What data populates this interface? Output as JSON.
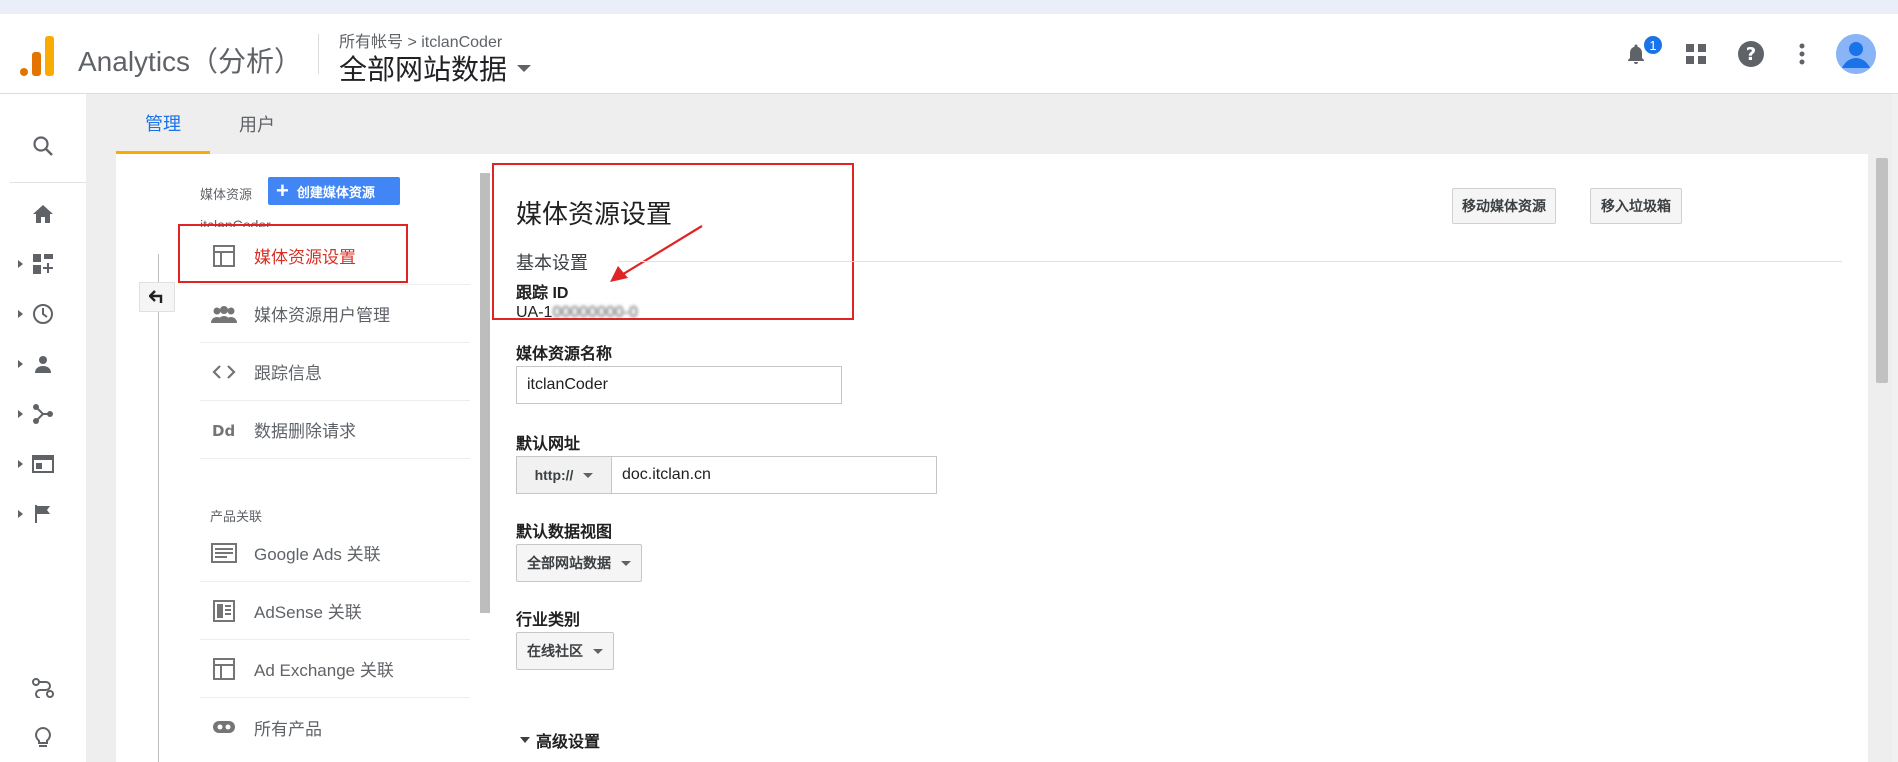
{
  "header": {
    "app_title": "Analytics（分析）",
    "breadcrumb": "所有帐号 > itclanCoder",
    "view_title": "全部网站数据",
    "notification_count": "1",
    "icons": [
      "notifications-icon",
      "apps-grid-icon",
      "help-icon",
      "more-vert-icon",
      "account-avatar"
    ]
  },
  "rail": {
    "icons": [
      "search-icon",
      "home-icon",
      "customization-icon",
      "realtime-clock-icon",
      "audience-person-icon",
      "acquisition-icon",
      "behavior-icon",
      "conversions-flag-icon",
      "attribution-icon",
      "lightbulb-icon"
    ]
  },
  "tabs": [
    {
      "label": "管理"
    },
    {
      "label": "用户"
    }
  ],
  "property": {
    "section_label": "媒体资源",
    "create_button": "创建媒体资源",
    "name": "itclanCoder",
    "nav": [
      {
        "label": "媒体资源设置"
      },
      {
        "label": "媒体资源用户管理"
      },
      {
        "label": "跟踪信息"
      },
      {
        "label": "数据删除请求"
      }
    ],
    "product_links_heading": "产品关联",
    "links": [
      {
        "label": "Google Ads 关联"
      },
      {
        "label": "AdSense 关联"
      },
      {
        "label": "Ad Exchange 关联"
      },
      {
        "label": "所有产品"
      }
    ]
  },
  "settings": {
    "title": "媒体资源设置",
    "move_button": "移动媒体资源",
    "trash_button": "移入垃圾箱",
    "basic_heading": "基本设置",
    "tracking_id_label": "跟踪 ID",
    "tracking_id_prefix": "UA-1",
    "tracking_id_hidden": "00000000-0",
    "property_name_label": "媒体资源名称",
    "property_name_value": "itclanCoder",
    "default_url_label": "默认网址",
    "protocol": "http://",
    "default_url_value": "doc.itclan.cn",
    "default_view_label": "默认数据视图",
    "default_view_value": "全部网站数据",
    "industry_label": "行业类别",
    "industry_value": "在线社区",
    "advanced_label": "高级设置"
  },
  "colors": {
    "accent": "#1a73e8",
    "active_nav": "#d93025",
    "highlight_box": "#e02424",
    "tab_underline": "#f9ab00"
  }
}
